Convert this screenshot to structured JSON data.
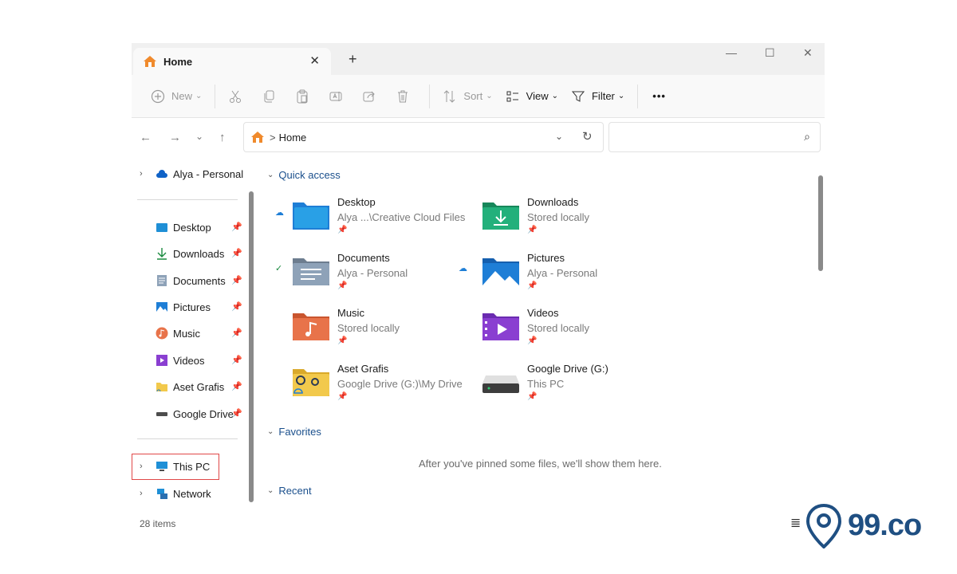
{
  "tab": {
    "title": "Home",
    "close": "✕",
    "new_tab": "+"
  },
  "window_controls": {
    "minimize": "—",
    "maximize": "☐",
    "close": "✕"
  },
  "toolbar": {
    "new": "New",
    "sort": "Sort",
    "view": "View",
    "filter": "Filter",
    "more": "•••"
  },
  "address": {
    "path": "Home",
    "separator": ">"
  },
  "sidebar": {
    "account": "Alya - Personal",
    "pinned": [
      {
        "label": "Desktop",
        "icon": "desktop-icon"
      },
      {
        "label": "Downloads",
        "icon": "downloads-icon"
      },
      {
        "label": "Documents",
        "icon": "documents-icon"
      },
      {
        "label": "Pictures",
        "icon": "pictures-icon"
      },
      {
        "label": "Music",
        "icon": "music-icon"
      },
      {
        "label": "Videos",
        "icon": "videos-icon"
      },
      {
        "label": "Aset Grafis",
        "icon": "folder-icon"
      },
      {
        "label": "Google Drive",
        "icon": "drive-icon"
      }
    ],
    "this_pc": "This PC",
    "network": "Network"
  },
  "main": {
    "quick_access": "Quick access",
    "favorites": "Favorites",
    "recent": "Recent",
    "favorites_empty": "After you've pinned some files, we'll show them here.",
    "items": [
      {
        "name": "Desktop",
        "sub": "Alya ...\\Creative Cloud Files",
        "status": "cloud"
      },
      {
        "name": "Downloads",
        "sub": "Stored locally",
        "status": ""
      },
      {
        "name": "Documents",
        "sub": "Alya - Personal",
        "status": "synced"
      },
      {
        "name": "Pictures",
        "sub": "Alya - Personal",
        "status": "cloud"
      },
      {
        "name": "Music",
        "sub": "Stored locally",
        "status": ""
      },
      {
        "name": "Videos",
        "sub": "Stored locally",
        "status": ""
      },
      {
        "name": "Aset Grafis",
        "sub": "Google Drive (G:)\\My Drive",
        "status": "cloud"
      },
      {
        "name": "Google Drive (G:)",
        "sub": "This PC",
        "status": ""
      }
    ]
  },
  "status": {
    "items": "28 items"
  },
  "watermark": {
    "text": "99.co"
  },
  "colors": {
    "accent": "#0067c0",
    "highlight": "#e04848",
    "section": "#1a4f8c"
  }
}
